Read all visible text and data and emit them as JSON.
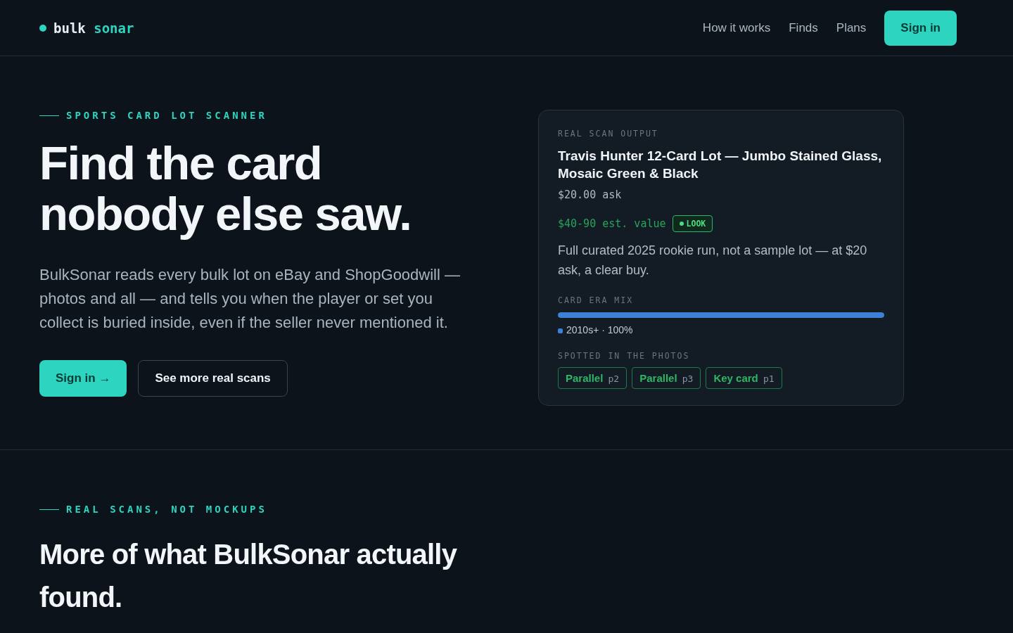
{
  "logo": {
    "word1": "bulk",
    "word2": "sonar"
  },
  "nav": {
    "links": [
      "How it works",
      "Finds",
      "Plans"
    ],
    "button": "Sign in"
  },
  "hero": {
    "eyebrow": "SPORTS CARD LOT SCANNER",
    "title_line1": "Find the card",
    "title_line2": "nobody else saw.",
    "body": "BulkSonar reads every bulk lot on eBay and ShopGoodwill — photos and all — and tells you when the player or set you collect is buried inside, even if the seller never mentioned it.",
    "primary_button": "Sign in →",
    "secondary_button": "See more real scans"
  },
  "scan_card": {
    "label": "REAL SCAN OUTPUT",
    "title": "Travis Hunter 12-Card Lot — Jumbo Stained Glass, Mosaic Green & Black",
    "ask": "$20.00 ask",
    "estimate": "$40-90 est. value",
    "verdict": "LOOK",
    "note": "Full curated 2025 rookie run, not a sample lot — at $20 ask, a clear buy.",
    "era_label": "CARD ERA MIX",
    "eras": [
      {
        "label": "2010s+ · 100%",
        "level": 1,
        "color": "#3b82d6"
      }
    ],
    "spotted_label": "SPOTTED IN THE PHOTOS",
    "tags": [
      {
        "name": "Parallel",
        "page": "p2"
      },
      {
        "name": "Parallel",
        "page": "p3"
      },
      {
        "name": "Key card",
        "page": "p1"
      }
    ]
  },
  "section2": {
    "eyebrow": "REAL SCANS, NOT MOCKUPS",
    "title": "More of what BulkSonar actually found."
  }
}
